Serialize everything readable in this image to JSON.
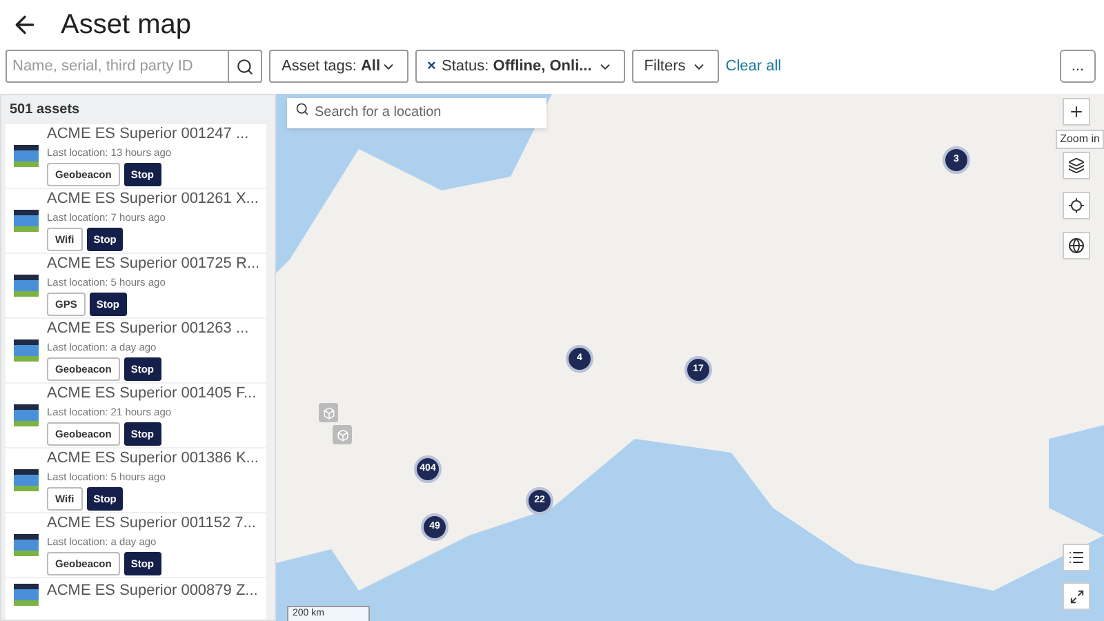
{
  "header": {
    "title": "Asset map"
  },
  "filters": {
    "search_placeholder": "Name, serial, third party ID",
    "asset_tags": {
      "label": "Asset tags:",
      "value": "All"
    },
    "status": {
      "remove": "×",
      "label": "Status:",
      "value": "Offline, Onli..."
    },
    "filters_button": "Filters",
    "clear_all": "Clear all",
    "more": "..."
  },
  "asset_list": {
    "count": "501 assets",
    "items": [
      {
        "name": "ACME  ES Superior 001247 ...",
        "location": "Last location: 13 hours ago",
        "tag": "Geobeacon",
        "action": "Stop"
      },
      {
        "name": "ACME  ES Superior 001261 X...",
        "location": "Last location: 7 hours ago",
        "tag": "Wifi",
        "action": "Stop"
      },
      {
        "name": "ACME  ES Superior 001725 R...",
        "location": "Last location: 5 hours ago",
        "tag": "GPS",
        "action": "Stop"
      },
      {
        "name": "ACME  ES Superior 001263 ...",
        "location": "Last location: a day ago",
        "tag": "Geobeacon",
        "action": "Stop"
      },
      {
        "name": "ACME  ES Superior 001405 F...",
        "location": "Last location: 21 hours ago",
        "tag": "Geobeacon",
        "action": "Stop"
      },
      {
        "name": "ACME  ES Superior 001386 K...",
        "location": "Last location: 5 hours ago",
        "tag": "Wifi",
        "action": "Stop"
      },
      {
        "name": "ACME  ES Superior 001152 7...",
        "location": "Last location: a day ago",
        "tag": "Geobeacon",
        "action": "Stop"
      },
      {
        "name": "ACME  ES Superior 000879 Z..."
      }
    ]
  },
  "map": {
    "search_placeholder": "Search for a location",
    "zoom_tooltip": "Zoom in",
    "scale": "200 km",
    "clusters": [
      {
        "count": "3"
      },
      {
        "count": "4"
      },
      {
        "count": "17"
      },
      {
        "count": "404"
      },
      {
        "count": "22"
      },
      {
        "count": "49"
      }
    ]
  }
}
